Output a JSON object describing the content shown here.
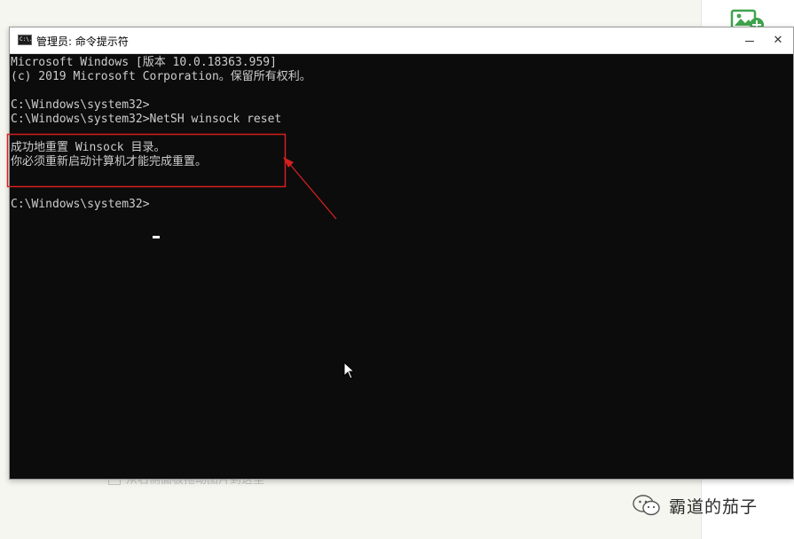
{
  "window": {
    "title": "管理员: 命令提示符",
    "icon": "console-icon",
    "icon_text": "C:\\.",
    "minimize_icon": "minimize-icon",
    "close_icon": "close-icon",
    "close_glyph": "✕"
  },
  "console": {
    "lines": [
      "Microsoft Windows [版本 10.0.18363.959]",
      "(c) 2019 Microsoft Corporation。保留所有权利。",
      "",
      "C:\\Windows\\system32>",
      "C:\\Windows\\system32>NetSH winsock reset",
      "",
      "成功地重置 Winsock 目录。",
      "你必须重新启动计算机才能完成重置。",
      "",
      "",
      "C:\\Windows\\system32>"
    ]
  },
  "background": {
    "hint_text": "从右侧面板拖动图片到这里",
    "side_icon": "add-image-icon"
  },
  "annotation": {
    "color": "#e02020"
  },
  "watermark": {
    "icon": "wechat-icon",
    "text": "霸道的茄子"
  }
}
